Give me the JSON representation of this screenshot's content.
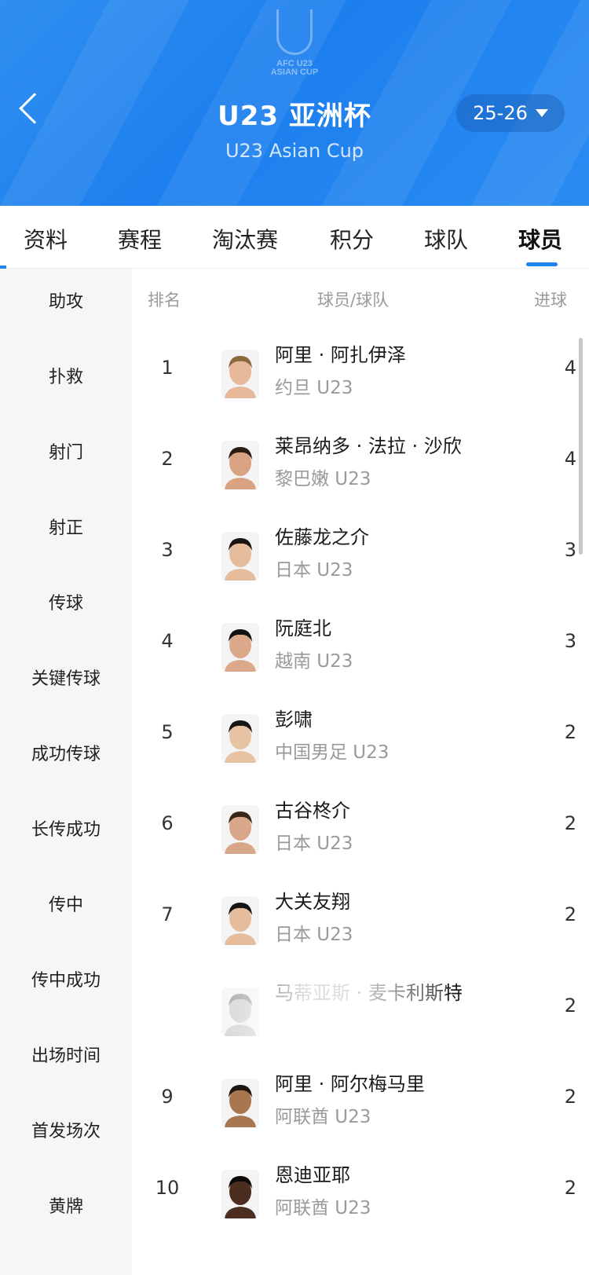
{
  "header": {
    "logo_line1": "AFC U23",
    "logo_line2": "ASIAN CUP",
    "title": "U23 亚洲杯",
    "subtitle": "U23 Asian Cup",
    "season": "25-26",
    "accent_color": "#1f86f0"
  },
  "tabs": [
    {
      "label": "资料",
      "active": false
    },
    {
      "label": "赛程",
      "active": false
    },
    {
      "label": "淘汰赛",
      "active": false
    },
    {
      "label": "积分",
      "active": false
    },
    {
      "label": "球队",
      "active": false
    },
    {
      "label": "球员",
      "active": true
    }
  ],
  "sidebar": {
    "items": [
      {
        "label": "助攻"
      },
      {
        "label": "扑救"
      },
      {
        "label": "射门"
      },
      {
        "label": "射正"
      },
      {
        "label": "传球"
      },
      {
        "label": "关键传球"
      },
      {
        "label": "成功传球"
      },
      {
        "label": "长传成功"
      },
      {
        "label": "传中"
      },
      {
        "label": "传中成功"
      },
      {
        "label": "出场时间"
      },
      {
        "label": "首发场次"
      },
      {
        "label": "黄牌"
      }
    ]
  },
  "table": {
    "headers": {
      "rank": "排名",
      "player": "球员/球队",
      "stat": "进球"
    },
    "rows": [
      {
        "rank": "1",
        "name": "阿里 · 阿扎伊泽",
        "team": "约旦 U23",
        "goals": "4"
      },
      {
        "rank": "2",
        "name": "莱昂纳多 · 法拉 · 沙欣",
        "team": "黎巴嫩 U23",
        "goals": "4"
      },
      {
        "rank": "3",
        "name": "佐藤龙之介",
        "team": "日本 U23",
        "goals": "3"
      },
      {
        "rank": "4",
        "name": "阮庭北",
        "team": "越南 U23",
        "goals": "3"
      },
      {
        "rank": "5",
        "name": "彭啸",
        "team": "中国男足 U23",
        "goals": "2"
      },
      {
        "rank": "6",
        "name": "古谷柊介",
        "team": "日本 U23",
        "goals": "2"
      },
      {
        "rank": "7",
        "name": "大关友翔",
        "team": "日本 U23",
        "goals": "2"
      },
      {
        "rank": "",
        "name": "马蒂亚斯 · 麦卡利斯特",
        "team": "",
        "goals": "2"
      },
      {
        "rank": "9",
        "name": "阿里 · 阿尔梅马里",
        "team": "阿联酋 U23",
        "goals": "2"
      },
      {
        "rank": "10",
        "name": "恩迪亚耶",
        "team": "阿联酋 U23",
        "goals": "2"
      }
    ]
  }
}
